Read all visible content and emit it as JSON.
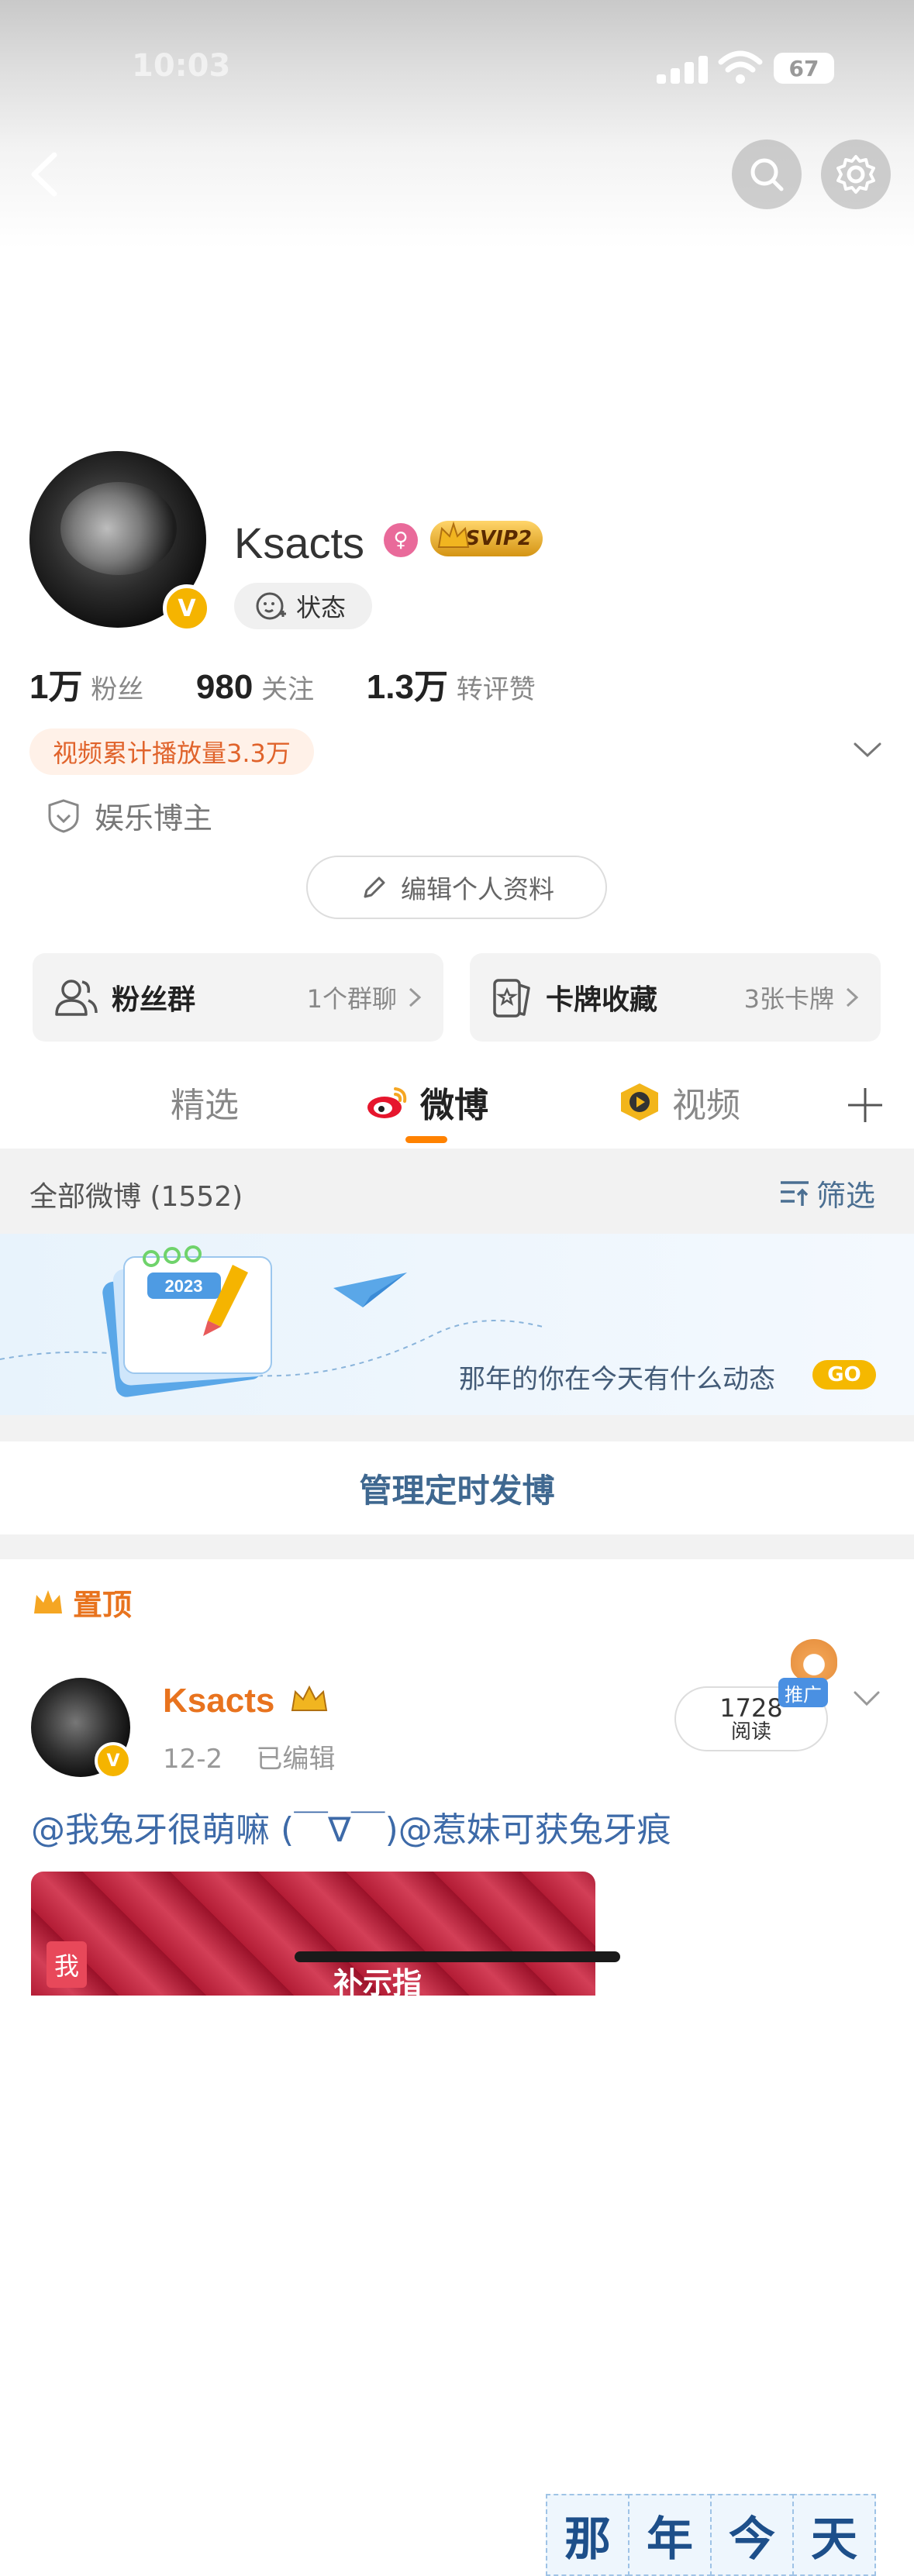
{
  "status_bar": {
    "time": "10:03",
    "battery": "67"
  },
  "profile": {
    "username": "Ksacts",
    "gender_icon": "female-icon",
    "vip_badge": "SVIP2",
    "status_label": "状态",
    "stats": {
      "fans_value": "1万",
      "fans_label": "粉丝",
      "following_value": "980",
      "following_label": "关注",
      "interactions_value": "1.3万",
      "interactions_label": "转评赞"
    },
    "video_plays": "视频累计播放量3.3万",
    "category": "娱乐博主",
    "edit_label": "编辑个人资料"
  },
  "cards": [
    {
      "title": "粉丝群",
      "sub": "1个群聊"
    },
    {
      "title": "卡牌收藏",
      "sub": "3张卡牌"
    }
  ],
  "tabs": [
    {
      "label": "精选"
    },
    {
      "label": "微博"
    },
    {
      "label": "视频"
    }
  ],
  "feed_header": {
    "all_label": "全部微博 (1552)",
    "filter_label": "筛选"
  },
  "banner": {
    "chars": [
      "那",
      "年",
      "今",
      "天"
    ],
    "subtitle": "那年的你在今天有什么动态",
    "go_label": "GO",
    "calendar_year": "2023"
  },
  "manage_label": "管理定时发博",
  "pinned_label": "置顶",
  "post": {
    "author": "Ksacts",
    "date": "12-2",
    "edited": "已编辑",
    "read_count": "1728",
    "read_label": "阅读",
    "promo_label": "推广",
    "text": "@我兔牙很萌嘛 (￣∇￣)@惹妹可获兔牙痕",
    "media_tag": "我",
    "media_caption": "补示指"
  },
  "colors": {
    "accent_orange": "#ff8200",
    "link_blue": "#3d6aa8",
    "vip_gold": "#f5b400"
  }
}
